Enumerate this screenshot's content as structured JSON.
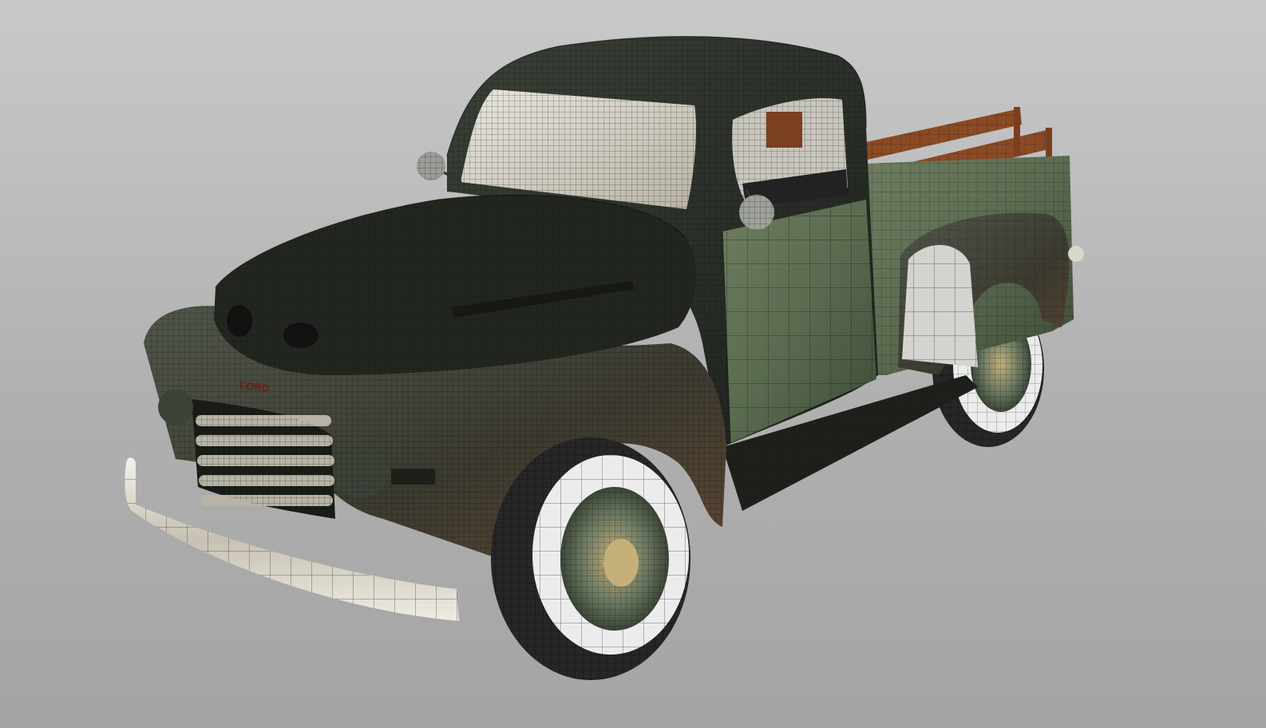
{
  "viewport": {
    "background": {
      "top_color": "#c9c9c9",
      "mid_color": "#b0b0b0",
      "bottom_color": "#a4a4a4"
    }
  },
  "model": {
    "kind": "vintage pickup truck, textured 3D model with wireframe overlay",
    "colors": {
      "body_dark": "#2b302a",
      "body_green": "#4d5d45",
      "body_light": "#7d8a6e",
      "hood_dark": "#22261f",
      "rust": "#5b4531",
      "chrome": "#d9d6cc",
      "tire": "#262626",
      "whitewall": "#ececec",
      "wood_rail": "#8a4a25",
      "wire": "#0f110e",
      "glass": "#d8d6cf"
    },
    "grille_badge_text": "FORD"
  }
}
